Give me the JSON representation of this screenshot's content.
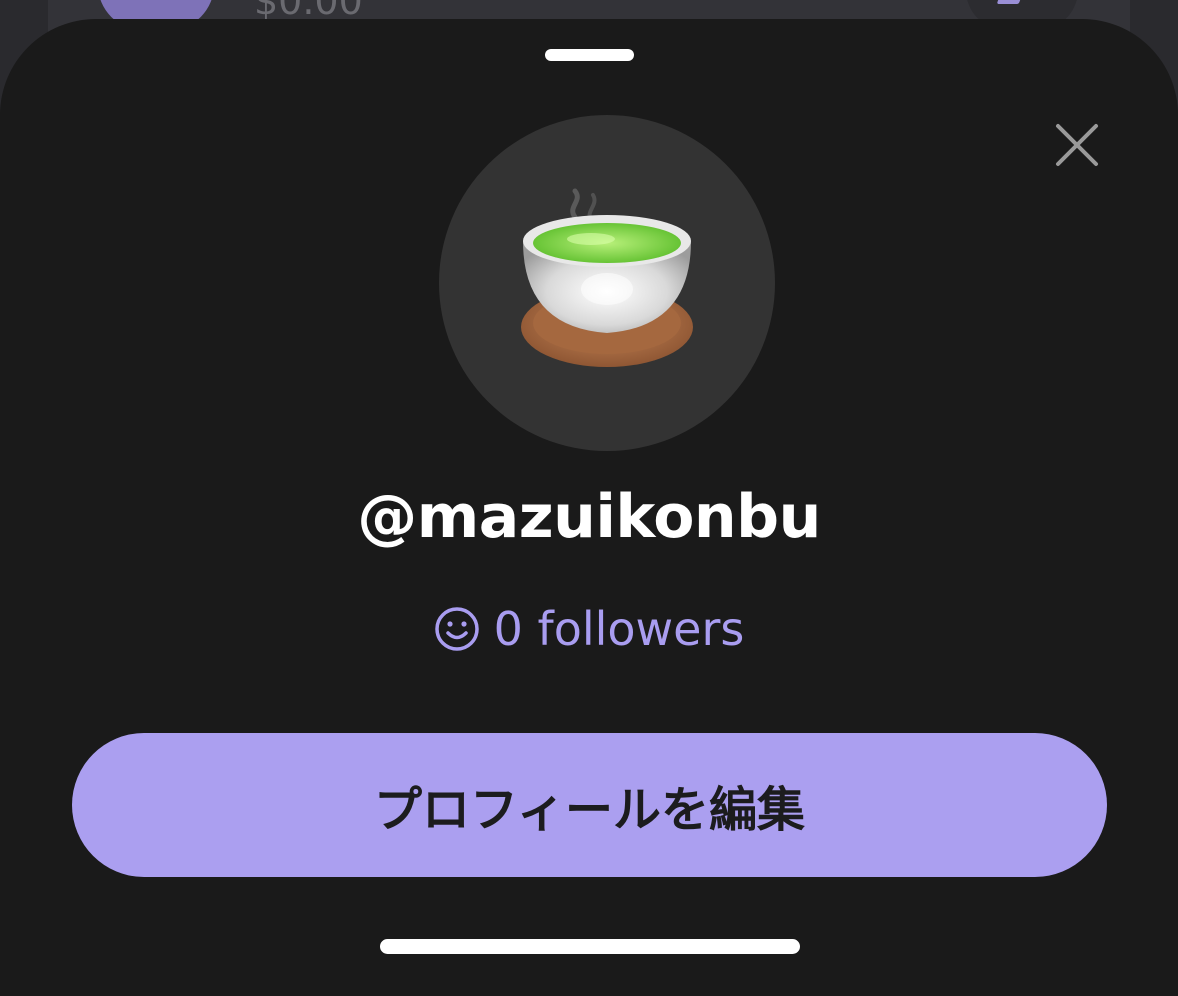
{
  "background": {
    "amount": "$0.00"
  },
  "profile": {
    "avatar_icon": "teacup-emoji-icon",
    "username": "@mazuikonbu",
    "followers_icon": "smiley-icon",
    "followers_text": "0 followers"
  },
  "actions": {
    "edit_profile_label": "プロフィールを編集",
    "close_icon": "close-icon"
  },
  "colors": {
    "sheet_background": "#1a1a1a",
    "accent": "#ab9ff0",
    "followers_text": "#a99df0",
    "avatar_circle": "#333333"
  }
}
